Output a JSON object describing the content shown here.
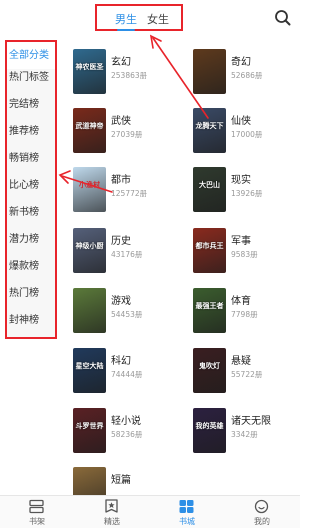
{
  "header": {
    "tabs": [
      {
        "label": "男生",
        "active": true
      },
      {
        "label": "女生",
        "active": false
      }
    ],
    "search_icon": "search-icon"
  },
  "sidebar": {
    "items": [
      {
        "label": "全部分类",
        "active": true
      },
      {
        "label": "热门标签",
        "active": false
      },
      {
        "label": "完结榜",
        "active": false
      },
      {
        "label": "推荐榜",
        "active": false
      },
      {
        "label": "畅销榜",
        "active": false
      },
      {
        "label": "比心榜",
        "active": false
      },
      {
        "label": "新书榜",
        "active": false
      },
      {
        "label": "潜力榜",
        "active": false
      },
      {
        "label": "爆款榜",
        "active": false
      },
      {
        "label": "热门榜",
        "active": false
      },
      {
        "label": "封神榜",
        "active": false
      }
    ]
  },
  "categories": [
    {
      "name": "玄幻",
      "count": "253863册",
      "cover_text": "神农医圣",
      "color": "#2f6a8f"
    },
    {
      "name": "奇幻",
      "count": "52686册",
      "cover_text": "",
      "color": "#5e3a1d"
    },
    {
      "name": "武侠",
      "count": "27039册",
      "cover_text": "武道神帝",
      "color": "#7a2a1b"
    },
    {
      "name": "仙侠",
      "count": "17000册",
      "cover_text": "龙腾天下",
      "color": "#3a4a66"
    },
    {
      "name": "都市",
      "count": "125772册",
      "cover_text": "小渔村",
      "color": "#bfd9ec"
    },
    {
      "name": "现实",
      "count": "13926册",
      "cover_text": "大巴山",
      "color": "#2f3a2e"
    },
    {
      "name": "历史",
      "count": "43176册",
      "cover_text": "神级小厨",
      "color": "#55607a"
    },
    {
      "name": "军事",
      "count": "9583册",
      "cover_text": "都市兵王",
      "color": "#8a2a1e"
    },
    {
      "name": "游戏",
      "count": "54453册",
      "cover_text": "",
      "color": "#5b7a3a"
    },
    {
      "name": "体育",
      "count": "7798册",
      "cover_text": "最强王者",
      "color": "#3b5d2e"
    },
    {
      "name": "科幻",
      "count": "74444册",
      "cover_text": "星空大陆",
      "color": "#203a5c"
    },
    {
      "name": "悬疑",
      "count": "55722册",
      "cover_text": "鬼吹灯",
      "color": "#3a1e20"
    },
    {
      "name": "轻小说",
      "count": "58236册",
      "cover_text": "斗罗世界",
      "color": "#5a2024"
    },
    {
      "name": "诸天无限",
      "count": "3342册",
      "cover_text": "我的英雄",
      "color": "#2c2040"
    },
    {
      "name": "短篇",
      "count": "",
      "cover_text": "",
      "color": "#8a6a3a"
    }
  ],
  "bottom_nav": {
    "items": [
      {
        "label": "书架",
        "icon": "bookshelf-icon",
        "active": false
      },
      {
        "label": "精选",
        "icon": "star-badge-icon",
        "active": false
      },
      {
        "label": "书城",
        "icon": "bookstore-icon",
        "active": true
      },
      {
        "label": "我的",
        "icon": "profile-icon",
        "active": false
      }
    ]
  },
  "colors": {
    "accent": "#2d8fe6",
    "annotation_red": "#e8242b",
    "sidebar_bg": "#f7f7f7",
    "muted_text": "#999999"
  }
}
